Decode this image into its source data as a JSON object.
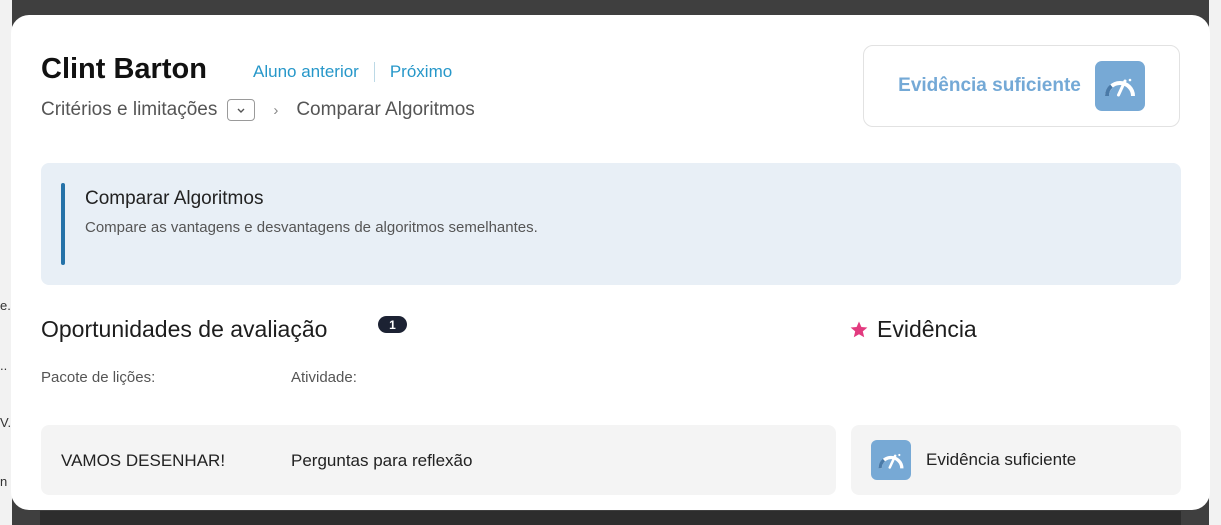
{
  "student": {
    "name": "Clint Barton",
    "prev_label": "Aluno anterior",
    "next_label": "Próximo"
  },
  "breadcrumb": {
    "criteria": "Critérios e limitações",
    "current": "Comparar Algoritmos",
    "separator": "›"
  },
  "evidence_status": {
    "label": "Evidência suficiente",
    "icon": "gauge-icon"
  },
  "standard": {
    "title": "Comparar Algoritmos",
    "description": "Compare as vantagens e desvantagens de algoritmos semelhantes."
  },
  "assessment": {
    "title": "Oportunidades de avaliação",
    "count": "1",
    "col_lesson": "Pacote de lições:",
    "col_activity": "Atividade:",
    "rows": [
      {
        "lesson": "VAMOS DESENHAR!",
        "activity": "Perguntas para reflexão"
      }
    ]
  },
  "evidence": {
    "title": "Evidência",
    "icon": "star-icon",
    "rows": [
      {
        "label": "Evidência suficiente",
        "icon": "gauge-icon"
      }
    ]
  },
  "background": {
    "fragments": [
      "e.",
      "..",
      "V.",
      "n"
    ]
  },
  "colors": {
    "accent_link": "#2697c9",
    "gauge": "#77a9d5",
    "star": "#e23a7f",
    "info_bar": "#2572a8"
  }
}
